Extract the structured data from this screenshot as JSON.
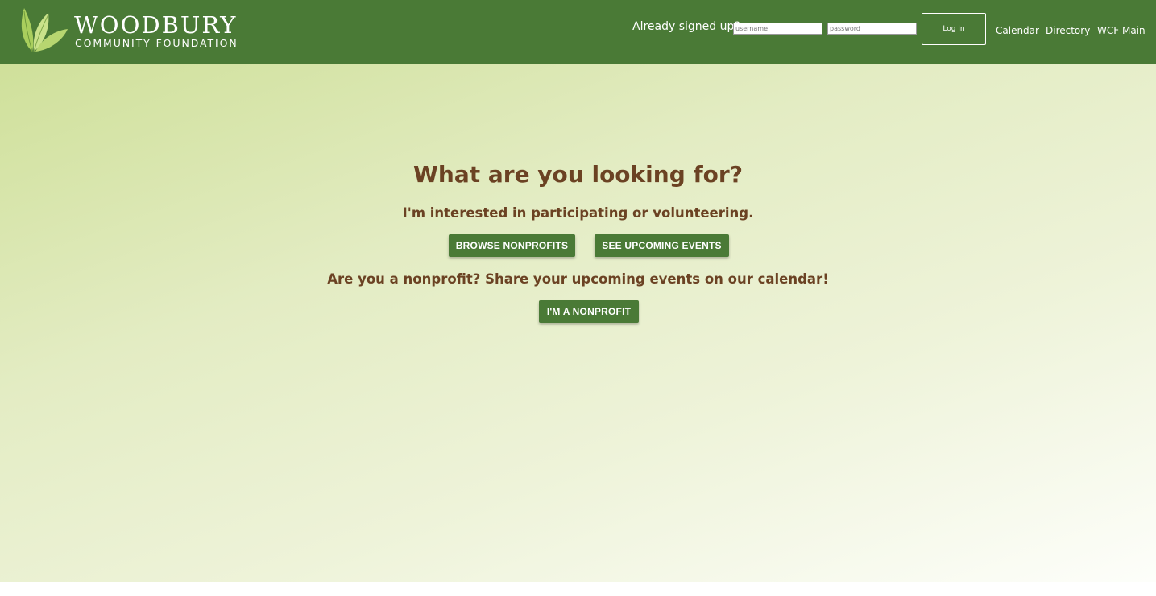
{
  "header": {
    "logo": {
      "title": "WOODBURY",
      "subtitle": "COMMUNITY FOUNDATION"
    },
    "signin_label": "Already signed up?",
    "username_placeholder": "username",
    "password_placeholder": "password",
    "login_label": "Log In",
    "nav": {
      "calendar": "Calendar",
      "directory": "Directory",
      "wcf_main": "WCF Main"
    }
  },
  "main": {
    "title": "What are you looking for?",
    "participate_text": "I'm interested in participating or volunteering.",
    "browse_label": "BROWSE NONPROFITS",
    "events_label": "SEE UPCOMING EVENTS",
    "nonprofit_text": "Are you a nonprofit? Share your upcoming events on our calendar!",
    "nonprofit_label": "I'M A NONPROFIT"
  },
  "colors": {
    "header_bg": "#4a7a36",
    "button_bg": "#4a7a36",
    "heading_text": "#6b4223",
    "hero_gradient_start": "#cfe09a",
    "hero_gradient_end": "#fdfefa"
  },
  "icons": {
    "logo_mark": "leaf-icon"
  }
}
